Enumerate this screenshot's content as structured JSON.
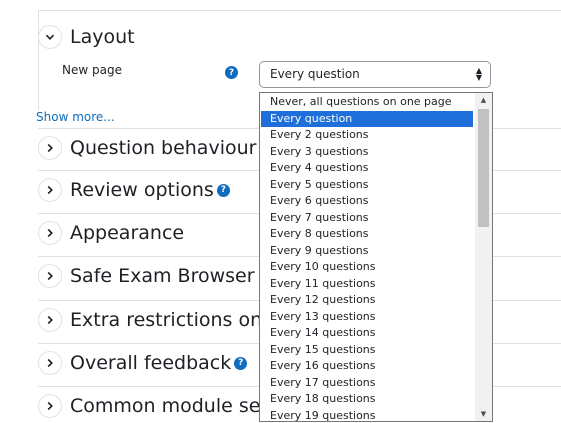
{
  "sections": [
    {
      "id": "layout",
      "title": "Layout",
      "expanded": true,
      "help": false
    },
    {
      "id": "question-behaviour",
      "title": "Question behaviour",
      "expanded": false,
      "help": false
    },
    {
      "id": "review-options",
      "title": "Review options",
      "expanded": false,
      "help": true
    },
    {
      "id": "appearance",
      "title": "Appearance",
      "expanded": false,
      "help": false
    },
    {
      "id": "safe-exam-browser",
      "title": "Safe Exam Browser",
      "expanded": false,
      "help": false
    },
    {
      "id": "extra-restrictions",
      "title": "Extra restrictions on attempts",
      "expanded": false,
      "help": false
    },
    {
      "id": "overall-feedback",
      "title": "Overall feedback",
      "expanded": false,
      "help": true
    },
    {
      "id": "common-module",
      "title": "Common module settings",
      "expanded": false,
      "help": false
    }
  ],
  "layout": {
    "new_page_label": "New page",
    "help_glyph": "?",
    "select_value": "Every question",
    "show_more": "Show more..."
  },
  "dropdown": {
    "selected_index": 1,
    "options": [
      "Never, all questions on one page",
      "Every question",
      "Every 2 questions",
      "Every 3 questions",
      "Every 4 questions",
      "Every 5 questions",
      "Every 6 questions",
      "Every 7 questions",
      "Every 8 questions",
      "Every 9 questions",
      "Every 10 questions",
      "Every 11 questions",
      "Every 12 questions",
      "Every 13 questions",
      "Every 14 questions",
      "Every 15 questions",
      "Every 16 questions",
      "Every 17 questions",
      "Every 18 questions",
      "Every 19 questions"
    ]
  },
  "colors": {
    "accent": "#0f6cbf",
    "selected_option": "#1e6fd9",
    "divider": "#dee2e6"
  }
}
